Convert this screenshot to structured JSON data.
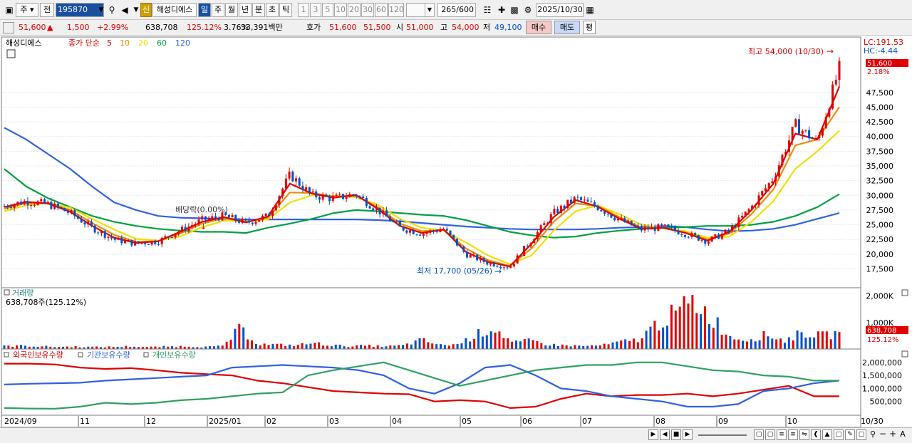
{
  "toolbar": {
    "period_btn": "주",
    "prev_btn": "전",
    "code": "195870",
    "shin_badge": "신",
    "name": "해성디에스",
    "period_tabs": [
      "일",
      "주",
      "월",
      "년",
      "분",
      "초",
      "틱"
    ],
    "interval_tabs": [
      "1",
      "3",
      "5",
      "10",
      "20",
      "30",
      "60",
      "120"
    ],
    "count": "265",
    "count_total": "/600",
    "date": "2025/10/30"
  },
  "quote": {
    "price": "51,600",
    "change": "1,500",
    "change_pct": "+2.99%",
    "volume": "638,708",
    "vol_ratio": "125.12%",
    "turnover": "3.76%",
    "amount": "33,391백만",
    "hoga_label": "호가",
    "ask": "51,600",
    "bid": "51,500",
    "open_label": "시",
    "open": "51,000",
    "high_label": "고",
    "high": "54,000",
    "low_label": "저",
    "low": "49,100",
    "buy_label": "매수",
    "sell_label": "매도",
    "avg_label": "평"
  },
  "price_panel": {
    "title": "해성디에스",
    "ma_header": "종가 단순",
    "ma_periods": [
      "5",
      "10",
      "20",
      "60",
      "120"
    ],
    "lc_label": "LC:191.53",
    "hc_label": "HC:-4.44",
    "current_tag": "51,600",
    "current_pct": "2.18%",
    "high_note": "최고 54,000 (10/30)",
    "low_note": "최저 17,700 (05/26)",
    "dividend_note": "배당락(0.00%)"
  },
  "volume_panel": {
    "title": "거래량",
    "summary": "638,708주(125.12%)",
    "tag": "638,708",
    "tag_pct": "125.12%"
  },
  "holdings_panel": {
    "labels": [
      "외국인보유수량",
      "기관보유수량",
      "개인보유수량"
    ]
  },
  "colors": {
    "up": "#e00000",
    "down": "#0050c8",
    "ma5": "#e00000",
    "ma10": "#f08c00",
    "ma20": "#f0e000",
    "ma60": "#00a040",
    "ma120": "#3060e0",
    "foreign": "#e00000",
    "institution": "#3060e0",
    "individual": "#30a060"
  },
  "chart_data": [
    {
      "type": "line",
      "title": "해성디에스",
      "x": [
        "2024/09",
        "11",
        "12",
        "2025/01",
        "02",
        "03",
        "04",
        "05",
        "06",
        "07",
        "08",
        "09",
        "10",
        "10/30"
      ],
      "y_ticks": [
        17500,
        20000,
        22500,
        25000,
        27500,
        30000,
        32500,
        35000,
        37500,
        40000,
        42500,
        45000,
        47500
      ],
      "ylim": [
        15500,
        54500
      ],
      "series": [
        {
          "name": "종가",
          "values": [
            28200,
            29000,
            28500,
            27000,
            24500,
            22500,
            21800,
            22200,
            24000,
            25800,
            26500,
            25300,
            26500,
            33500,
            30000,
            29500,
            30200,
            27500,
            24500,
            23500,
            24300,
            20000,
            18500,
            17800,
            22500,
            27000,
            29500,
            28000,
            25800,
            24200,
            24600,
            23500,
            22200,
            24000,
            28000,
            33000,
            42000,
            39000,
            51600
          ]
        },
        {
          "name": "5",
          "values": [
            28000,
            28900,
            28600,
            27200,
            24800,
            22800,
            21900,
            22200,
            23800,
            25500,
            26300,
            25400,
            26400,
            32000,
            30300,
            29600,
            30100,
            27700,
            24800,
            23600,
            24200,
            20400,
            18700,
            17900,
            21800,
            26300,
            29200,
            28100,
            26000,
            24300,
            24500,
            23600,
            22300,
            23800,
            27500,
            32000,
            40500,
            39500,
            48500
          ]
        },
        {
          "name": "10",
          "values": [
            27700,
            28700,
            28700,
            27500,
            25300,
            23300,
            22100,
            22200,
            23500,
            25200,
            26100,
            25500,
            26200,
            30500,
            30400,
            29800,
            29900,
            28000,
            25200,
            23900,
            24100,
            21000,
            19000,
            18000,
            21000,
            25500,
            28600,
            28200,
            26300,
            24500,
            24400,
            23700,
            22500,
            23500,
            26800,
            31000,
            38500,
            39500,
            45000
          ]
        },
        {
          "name": "20",
          "values": [
            27300,
            28300,
            28700,
            27900,
            26000,
            24200,
            22600,
            22300,
            23000,
            24600,
            25700,
            25600,
            25900,
            28800,
            30000,
            29900,
            29700,
            28400,
            26000,
            24500,
            24000,
            22000,
            19800,
            18300,
            19800,
            24000,
            27300,
            28300,
            26800,
            25000,
            24400,
            23900,
            22800,
            23000,
            25500,
            29000,
            34500,
            37500,
            41000
          ]
        },
        {
          "name": "60",
          "values": [
            34500,
            31500,
            29500,
            28000,
            26500,
            25500,
            24800,
            24300,
            24000,
            23800,
            23800,
            23600,
            24500,
            25200,
            26000,
            27000,
            27500,
            27300,
            27000,
            26700,
            26500,
            25800,
            24800,
            23800,
            23200,
            22800,
            23000,
            23600,
            24000,
            24300,
            24500,
            24600,
            24800,
            24800,
            25000,
            25500,
            26500,
            28000,
            30200
          ]
        },
        {
          "name": "120",
          "values": [
            41500,
            39500,
            37000,
            34500,
            31500,
            28800,
            27500,
            26500,
            26200,
            26100,
            26000,
            25900,
            25900,
            25900,
            25900,
            25900,
            25900,
            25800,
            25600,
            25300,
            25000,
            24700,
            24500,
            24300,
            24200,
            24200,
            24200,
            24300,
            24500,
            24600,
            24800,
            24600,
            24200,
            23900,
            24000,
            24300,
            25000,
            26000,
            27000
          ]
        }
      ],
      "annotations": [
        "최고 54,000 (10/30)",
        "최저 17,700 (05/26)",
        "배당락(0.00%)"
      ]
    },
    {
      "type": "bar",
      "title": "거래량",
      "y_ticks": [
        1000000,
        2000000
      ],
      "ylim": [
        0,
        2150000
      ],
      "values": [
        120000,
        140000,
        110000,
        90000,
        100000,
        80000,
        90000,
        110000,
        80000,
        100000,
        120000,
        90000,
        110000,
        850000,
        200000,
        180000,
        150000,
        250000,
        160000,
        120000,
        140000,
        110000,
        150000,
        380000,
        160000,
        200000,
        600000,
        900000,
        250000,
        350000,
        180000,
        150000,
        120000,
        160000,
        300000,
        400000,
        1100000,
        1500000,
        2000000,
        1300000,
        500000,
        400000,
        600000,
        350000,
        700000,
        550000,
        638708
      ]
    },
    {
      "type": "line",
      "labels": [
        "외국인보유수량",
        "기관보유수량",
        "개인보유수량"
      ],
      "y_ticks": [
        500000,
        1000000,
        1500000,
        2000000
      ],
      "ylim": [
        0,
        2350000
      ],
      "series": [
        {
          "name": "외국인보유수량",
          "values": [
            1950000,
            1950000,
            1920000,
            1800000,
            1750000,
            1780000,
            1700000,
            1600000,
            1550000,
            1500000,
            1300000,
            1200000,
            1050000,
            900000,
            850000,
            800000,
            780000,
            500000,
            550000,
            500000,
            250000,
            300000,
            600000,
            800000,
            700000,
            750000,
            750000,
            800000,
            700000,
            800000,
            950000,
            1100000,
            700000,
            700000
          ]
        },
        {
          "name": "기관보유수량",
          "values": [
            1150000,
            1180000,
            1200000,
            1220000,
            1300000,
            1350000,
            1400000,
            1450000,
            1500000,
            1800000,
            1850000,
            1900000,
            1850000,
            1800000,
            1700000,
            1500000,
            1000000,
            800000,
            1200000,
            1800000,
            1900000,
            1500000,
            1000000,
            900000,
            700000,
            600000,
            500000,
            300000,
            300000,
            400000,
            900000,
            1000000,
            1200000,
            1300000
          ]
        },
        {
          "name": "개인보유수량",
          "values": [
            250000,
            230000,
            220000,
            300000,
            450000,
            400000,
            450000,
            550000,
            600000,
            700000,
            800000,
            850000,
            1500000,
            1700000,
            1850000,
            2000000,
            1700000,
            1400000,
            1100000,
            1300000,
            1500000,
            1700000,
            1800000,
            1900000,
            1900000,
            2000000,
            2000000,
            1850000,
            1700000,
            1650000,
            1500000,
            1450000,
            1300000,
            1300000
          ]
        }
      ]
    }
  ]
}
